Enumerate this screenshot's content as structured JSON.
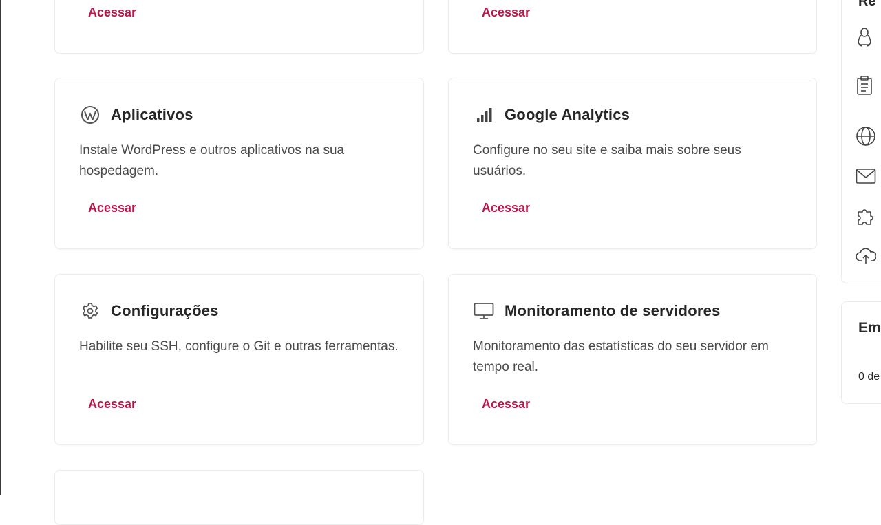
{
  "cards": {
    "top_left": {
      "link": "Acessar"
    },
    "top_right": {
      "link": "Acessar"
    },
    "aplicativos": {
      "icon": "wordpress-icon",
      "title": "Aplicativos",
      "description": "Instale WordPress e outros aplicativos na sua hospedagem.",
      "link": "Acessar"
    },
    "analytics": {
      "icon": "bar-chart-icon",
      "title": "Google Analytics",
      "description": "Configure no seu site e saiba mais sobre seus usuários.",
      "link": "Acessar"
    },
    "configuracoes": {
      "icon": "gear-icon",
      "title": "Configurações",
      "description": "Habilite seu SSH, configure o Git e outras ferramentas.",
      "link": "Acessar"
    },
    "monitoramento": {
      "icon": "monitor-icon",
      "title": "Monitoramento de servidores",
      "description": "Monitoramento das estatísticas do seu servidor em tempo real.",
      "link": "Acessar"
    }
  },
  "sidebar": {
    "top_heading": "Re",
    "icons": [
      "linux-icon",
      "clipboard-icon",
      "globe-icon",
      "mail-icon",
      "puzzle-icon",
      "cloud-upload-icon"
    ],
    "second_panel_heading": "Em",
    "second_panel_text": "0 de"
  },
  "colors": {
    "accent": "#b8194a",
    "border": "#ebebeb"
  }
}
